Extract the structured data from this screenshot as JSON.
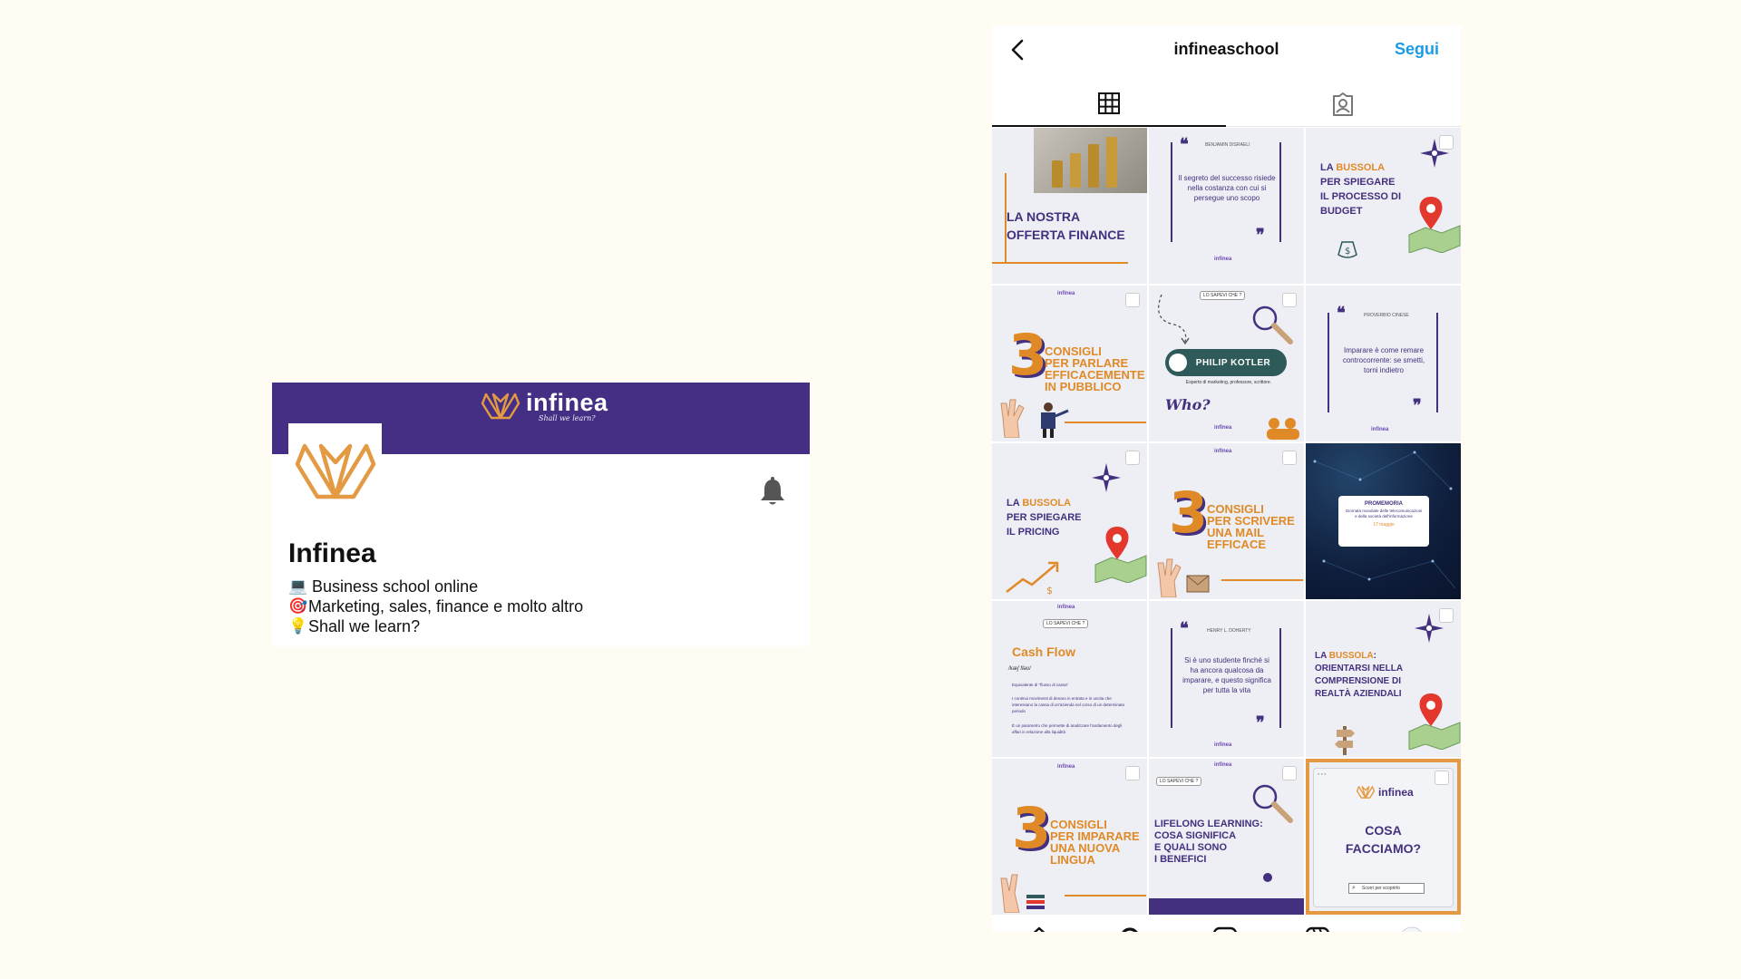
{
  "profile_card": {
    "banner_brand": "infinea",
    "banner_tagline": "Shall we learn?",
    "name": "Infinea",
    "bio": [
      {
        "emoji": "💻",
        "text": "Business school online"
      },
      {
        "emoji": "🎯",
        "text": "Marketing, sales, finance e molto altro"
      },
      {
        "emoji": "💡",
        "text": "Shall we learn?"
      }
    ]
  },
  "phone": {
    "username": "infineaschool",
    "follow_label": "Segui",
    "posts": {
      "finance": {
        "title_1": "LA NOSTRA",
        "title_2": "OFFERTA FINANCE"
      },
      "quote1": {
        "author": "BENJAMIN DISRAELI",
        "text": "Il segreto del successo risiede nella costanza con cui si persegue uno scopo"
      },
      "budget": {
        "line1_a": "LA ",
        "line1_b": "BUSSOLA",
        "line2": "PER SPIEGARE",
        "line3": "IL PROCESSO DI",
        "line4": "BUDGET"
      },
      "speak": {
        "num": "3",
        "l1": "CONSIGLI",
        "l2": "PER PARLARE",
        "l3": "EFFICACEMENTE",
        "l4": "IN PUBBLICO"
      },
      "kotler": {
        "tag": "LO SAPEVI CHE ?",
        "name": "PHILIP KOTLER",
        "sub": "Esperto di marketing, professore, scrittore.",
        "who": "Who?"
      },
      "quote2": {
        "author": "PROVERBIO CINESE",
        "text": "Imparare è come remare controcorrente: se smetti, torni indietro"
      },
      "pricing": {
        "line1_a": "LA ",
        "line1_b": "BUSSOLA",
        "line2": "PER SPIEGARE",
        "line3": "IL PRICING"
      },
      "mail": {
        "num": "3",
        "l1": "CONSIGLI",
        "l2": "PER SCRIVERE",
        "l3": "UNA MAIL",
        "l4": "EFFICACE"
      },
      "reminder": {
        "head": "PROMEMORIA",
        "body": "Giornata mondiale delle telecomunicazioni e della società dell'informazione",
        "date": "17 maggio"
      },
      "cashflow": {
        "tag": "LO SAPEVI CHE ?",
        "title": "Cash Flow",
        "phon": "/kæʃ fləʊ/",
        "def": "Equivalente di \"flusso di cassa\"",
        "body": "I continui movimenti di denaro in entrata e in uscita che interessano la cassa di un'azienda nel corso di un determinato periodo",
        "body2": "È un parametro che permette di analizzare l'andamento degli affari in relazione alla liquidità"
      },
      "quote3": {
        "author": "HENRY L. DOHERTY",
        "text": "Si è uno studente finché si ha ancora qualcosa da imparare, e questo significa per tutta la vita"
      },
      "realta": {
        "line1_a": "LA ",
        "line1_b": "BUSSOLA",
        "line1_c": ":",
        "line2": "ORIENTARSI NELLA",
        "line3": "COMPRENSIONE DI",
        "line4": "REALTÀ AZIENDALI"
      },
      "lingua": {
        "num": "3",
        "l1": "CONSIGLI",
        "l2": "PER IMPARARE",
        "l3": "UNA NUOVA",
        "l4": "LINGUA"
      },
      "lifelong": {
        "tag": "LO SAPEVI CHE ?",
        "l1": "LIFELONG LEARNING:",
        "l2": "COSA SIGNIFICA",
        "l3": "E QUALI SONO",
        "l4": "I BENEFICI"
      },
      "about": {
        "brand": "infinea",
        "l1": "COSA",
        "l2": "FACCIAMO?",
        "search": "Scorri per scoprirlo"
      }
    }
  },
  "colors": {
    "brand_purple": "#452f85",
    "brand_orange": "#e08a27",
    "link_blue": "#1a9be5"
  }
}
